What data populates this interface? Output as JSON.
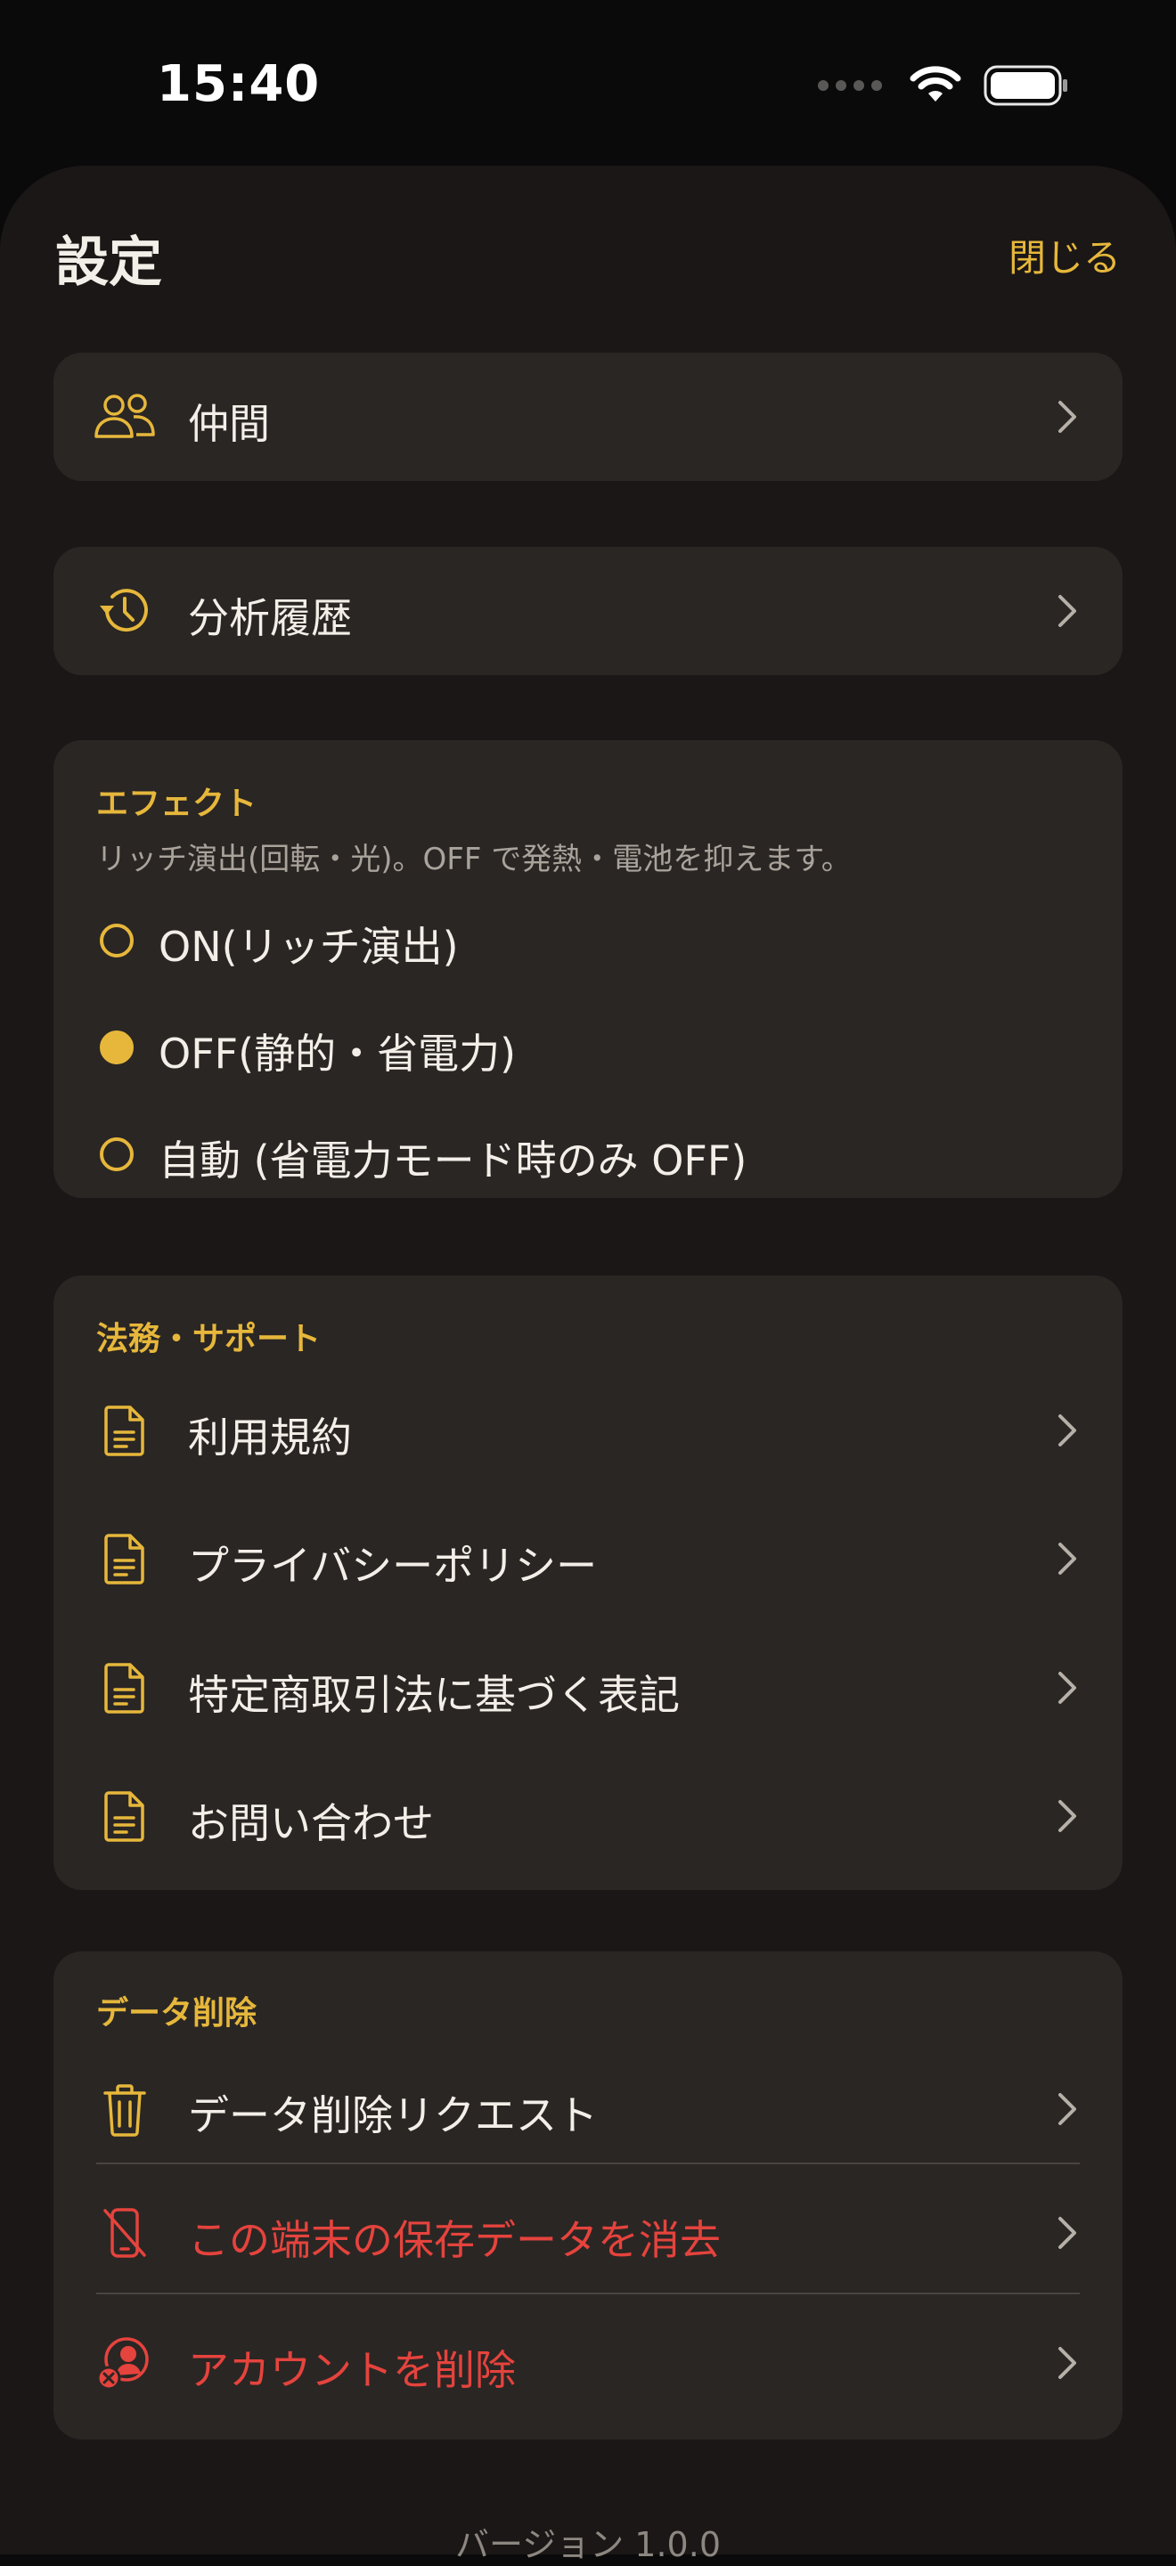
{
  "status_bar": {
    "time": "15:40"
  },
  "header": {
    "title": "設定",
    "close_label": "閉じる"
  },
  "nav": {
    "friends_label": "仲間",
    "history_label": "分析履歴"
  },
  "effects": {
    "title": "エフェクト",
    "description": "リッチ演出(回転・光)。OFF で発熱・電池を抑えます。",
    "options": [
      {
        "label": "ON(リッチ演出)",
        "selected": false
      },
      {
        "label": "OFF(静的・省電力)",
        "selected": true
      },
      {
        "label": "自動 (省電力モード時のみ OFF)",
        "selected": false
      }
    ]
  },
  "legal": {
    "title": "法務・サポート",
    "items": [
      {
        "label": "利用規約"
      },
      {
        "label": "プライバシーポリシー"
      },
      {
        "label": "特定商取引法に基づく表記"
      },
      {
        "label": "お問い合わせ"
      }
    ]
  },
  "data_delete": {
    "title": "データ削除",
    "items": [
      {
        "label": "データ削除リクエスト"
      },
      {
        "label": "この端末の保存データを消去"
      },
      {
        "label": "アカウントを削除"
      }
    ]
  },
  "footer": {
    "version": "バージョン 1.0.0"
  },
  "colors": {
    "accent": "#e6b73b",
    "danger": "#e5433d",
    "card": "#2a2624",
    "background": "#1a1716"
  }
}
